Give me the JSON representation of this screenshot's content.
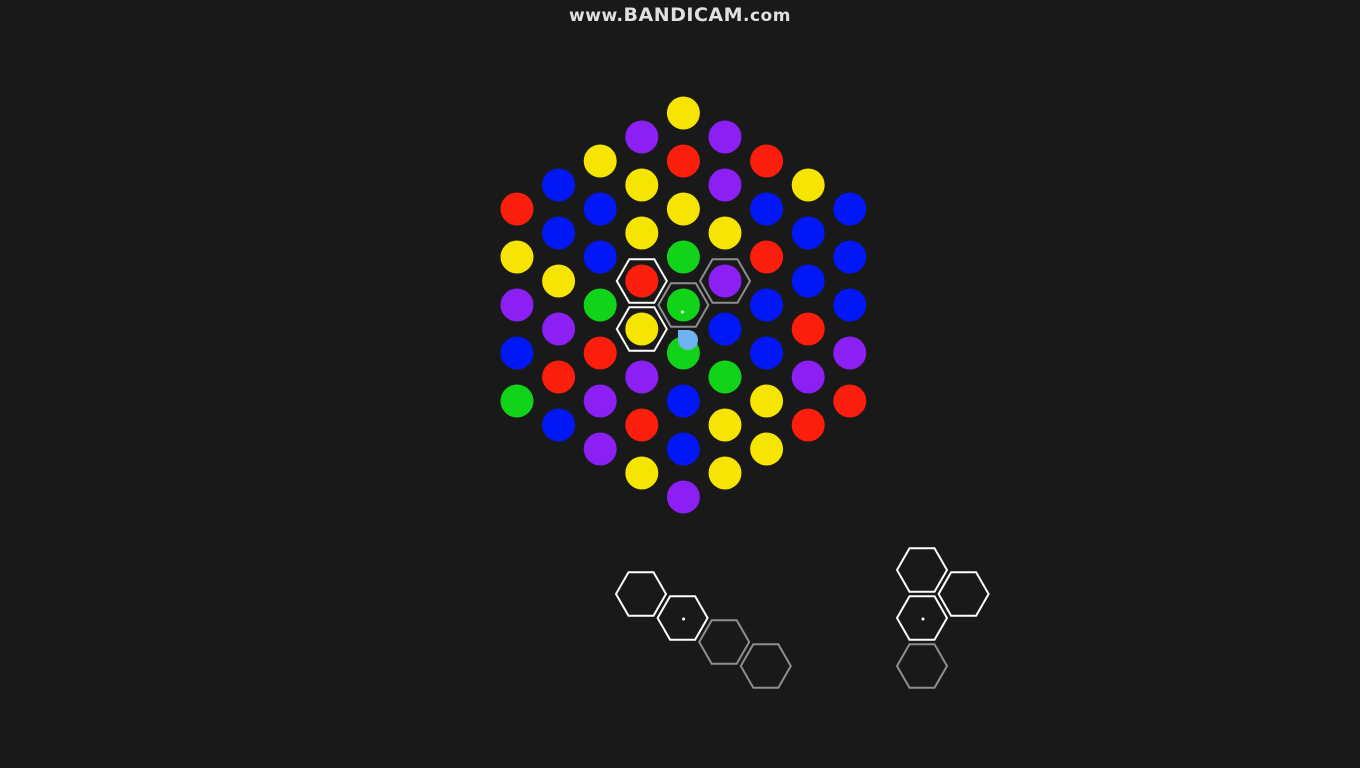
{
  "watermark": {
    "prefix": "www.",
    "brand": "BANDICAM",
    "suffix": ".com"
  },
  "colors": {
    "background": "#191919",
    "Y": "#f6e402",
    "P": "#8b1ff4",
    "R": "#fc1e0d",
    "B": "#0217f5",
    "G": "#11d41a",
    "outline_active": "#ffffff",
    "outline_ghost": "#8e8e8e",
    "cursor": "#71b2f0"
  },
  "board": {
    "columns": [
      [
        "R",
        "Y",
        "P",
        "B",
        "G"
      ],
      [
        "B",
        "B",
        "Y",
        "P",
        "R",
        "B"
      ],
      [
        "Y",
        "B",
        "B",
        "G",
        "R",
        "P",
        "P"
      ],
      [
        "P",
        "Y",
        "Y",
        "R",
        "Y",
        "P",
        "R",
        "Y"
      ],
      [
        "Y",
        "R",
        "Y",
        "G",
        "G",
        "G",
        "B",
        "B",
        "P"
      ],
      [
        "P",
        "P",
        "Y",
        "P",
        "B",
        "G",
        "Y",
        "Y"
      ],
      [
        "R",
        "B",
        "R",
        "B",
        "B",
        "Y",
        "Y"
      ],
      [
        "Y",
        "B",
        "B",
        "R",
        "P",
        "R"
      ],
      [
        "B",
        "B",
        "B",
        "P",
        "R"
      ]
    ]
  },
  "selection": {
    "active_cells": [
      [
        3,
        3
      ],
      [
        3,
        4
      ]
    ],
    "ghost_cells": [
      [
        4,
        4
      ],
      [
        5,
        3
      ]
    ],
    "cursor_dot_cell": [
      4,
      4
    ]
  },
  "pieces": [
    {
      "name": "piece-diagonal",
      "active": [
        [
          0,
          0
        ],
        [
          1,
          0
        ]
      ],
      "ghost": [
        [
          2,
          0
        ],
        [
          3,
          0
        ]
      ],
      "center": [
        1,
        0
      ]
    },
    {
      "name": "piece-cluster",
      "active": [
        [
          0,
          0
        ],
        [
          0,
          1
        ],
        [
          1,
          0
        ]
      ],
      "ghost": [
        [
          0,
          2
        ]
      ],
      "center": [
        0,
        1
      ]
    }
  ]
}
